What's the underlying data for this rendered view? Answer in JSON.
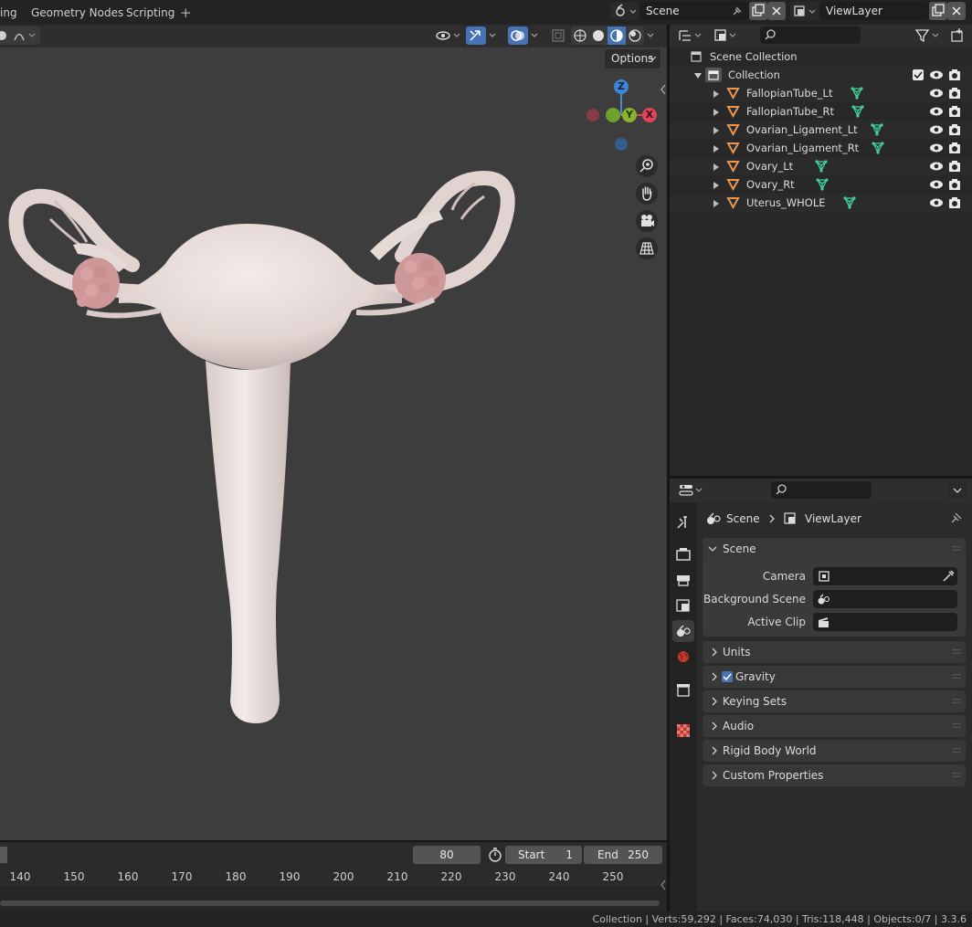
{
  "workspace_tabs": [
    "ing",
    "Geometry Nodes",
    "Scripting"
  ],
  "add_tab": "+",
  "scene_field": "Scene",
  "viewlayer_field": "ViewLayer",
  "viewport": {
    "options_label": "Options",
    "gizmo": {
      "z": "Z",
      "x": "X",
      "y": "Y"
    }
  },
  "timeline": {
    "current_frame": "80",
    "start_label": "Start",
    "start_value": "1",
    "end_label": "End",
    "end_value": "250",
    "ticks": [
      "140",
      "150",
      "160",
      "170",
      "180",
      "190",
      "200",
      "210",
      "220",
      "230",
      "240",
      "250"
    ]
  },
  "status_bar": "Collection | Verts:59,292 | Faces:74,030 | Tris:118,448 | Objects:0/7 | 3.3.6",
  "outliner": {
    "scene_collection": "Scene Collection",
    "collection": "Collection",
    "objects": [
      "FallopianTube_Lt",
      "FallopianTube_Rt",
      "Ovarian_Ligament_Lt",
      "Ovarian_Ligament_Rt",
      "Ovary_Lt",
      "Ovary_Rt",
      "Uterus_WHOLE"
    ]
  },
  "properties": {
    "breadcrumb_scene": "Scene",
    "breadcrumb_viewlayer": "ViewLayer",
    "scene_panel": "Scene",
    "camera_label": "Camera",
    "background_scene_label": "Background Scene",
    "active_clip_label": "Active Clip",
    "panels": [
      "Units",
      "Gravity",
      "Keying Sets",
      "Audio",
      "Rigid Body World",
      "Custom Properties"
    ]
  },
  "colors": {
    "accent_blue": "#4772b3",
    "object_orange": "#e9964f",
    "mesh_green": "#3fd09a",
    "model_skin": "#e6d9d6"
  },
  "icons": [
    "scene-icon",
    "pin-icon",
    "copy-icon",
    "close-icon",
    "viewlayer-icon",
    "search-icon",
    "filter-icon",
    "eye-icon",
    "camera-icon",
    "triangle-object-icon",
    "mesh-data-icon",
    "tool-icon",
    "render-icon",
    "output-icon",
    "view-layer-tab-icon",
    "scene-tab-icon",
    "world-icon",
    "collection-tab-icon",
    "texture-icon",
    "zoom-icon",
    "hand-icon",
    "camera-view-icon",
    "grid-icon",
    "timer-icon",
    "eyedropper-icon",
    "clip-icon"
  ]
}
